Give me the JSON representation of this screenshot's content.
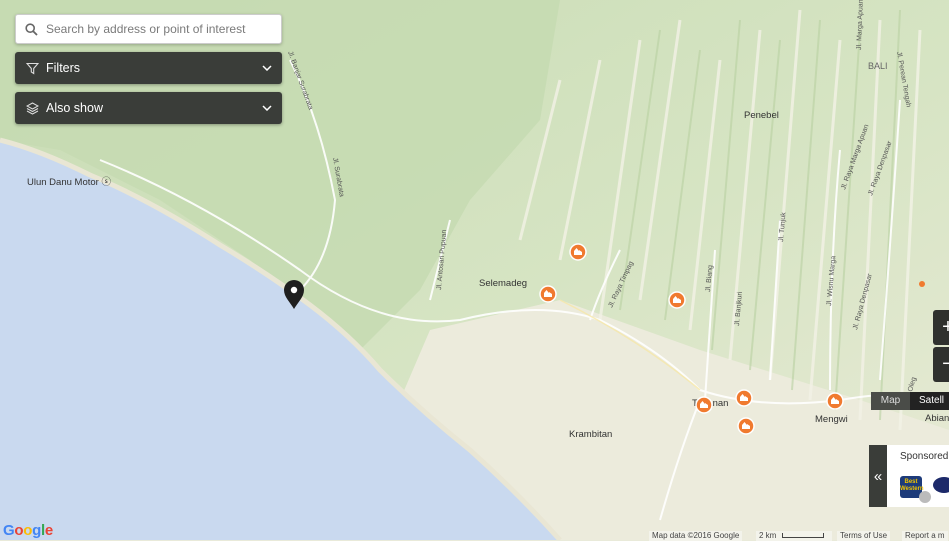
{
  "search": {
    "placeholder": "Search by address or point of interest"
  },
  "filters": {
    "label": "Filters",
    "icon": "filter-icon"
  },
  "also_show": {
    "label": "Also show",
    "icon": "layers-icon"
  },
  "map": {
    "place_labels": [
      {
        "id": "ulun",
        "text": "Ulun Danu Motor ⓢ"
      },
      {
        "id": "penebel",
        "text": "Penebel"
      },
      {
        "id": "selemadeg",
        "text": "Selemadeg"
      },
      {
        "id": "krambitan",
        "text": "Krambitan"
      },
      {
        "id": "mengwi",
        "text": "Mengwi"
      },
      {
        "id": "tabanan",
        "text": "Tabanan"
      },
      {
        "id": "bali",
        "text": "BALI"
      },
      {
        "id": "abian",
        "text": "Abian"
      }
    ],
    "road_labels": [
      {
        "id": "banjar",
        "text": "Jl. Banjar Surabrata"
      },
      {
        "id": "surabrata",
        "text": "Jl. Surabrata"
      },
      {
        "id": "antosari",
        "text": "Jl. Antosari Pupuan"
      },
      {
        "id": "timpag",
        "text": "Jl. Raya Timpag"
      },
      {
        "id": "biang",
        "text": "Jl. Biang"
      },
      {
        "id": "banjkuri",
        "text": "Jl. Banjkuri"
      },
      {
        "id": "tunjuk",
        "text": "Jl. Tunjuk"
      },
      {
        "id": "wisnu",
        "text": "Jl. Wisnu Marga"
      },
      {
        "id": "margaapuan",
        "text": "Jl. Raya Marga Apuan"
      },
      {
        "id": "denpasar1",
        "text": "Jl. Raya Denpasar"
      },
      {
        "id": "denpasar2",
        "text": "Jl. Raya Denpasar"
      },
      {
        "id": "pereantengah",
        "text": "Jl. Perean Tengah"
      },
      {
        "id": "margaapuan2",
        "text": "Jl. Marga Apuan"
      },
      {
        "id": "oleg",
        "text": "Oleg"
      }
    ],
    "marker_icon": "location-pin-icon",
    "poi_icon": "hotel-icon",
    "poi_count": 7
  },
  "zoom": {
    "in": "+",
    "out": "−"
  },
  "map_type": {
    "map": "Map",
    "satellite": "Satell"
  },
  "sponsored": {
    "title": "Sponsored",
    "toggle": "«",
    "logo1": "Best Western"
  },
  "footer": {
    "map_data": "Map data ©2016 Google",
    "scale": "2 km",
    "terms": "Terms of Use",
    "report": "Report a m"
  },
  "google_logo": "Google",
  "colors": {
    "water": "#c9d9ef",
    "land": "#e9ead9",
    "forest": "#cfe0bf",
    "poi": "#f07a2f",
    "panel": "#3a3d39"
  }
}
